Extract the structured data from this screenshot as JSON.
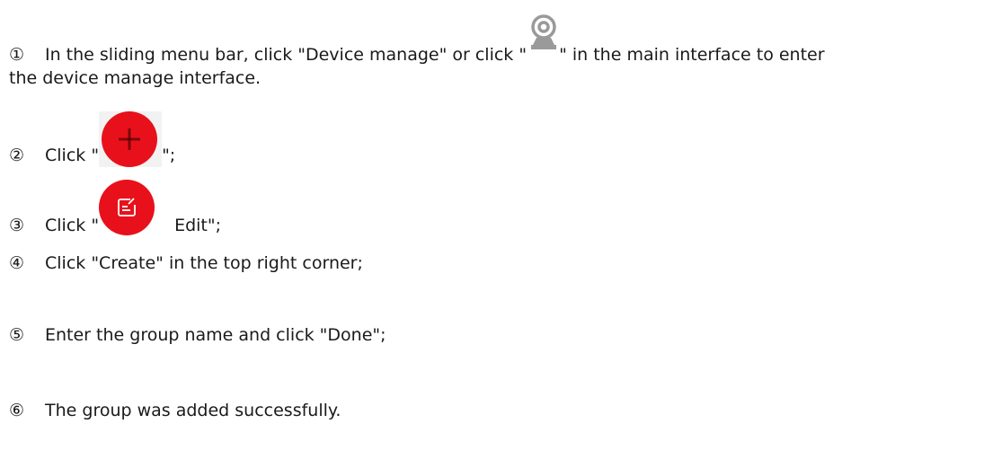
{
  "steps": [
    {
      "number": "①",
      "text_before": "In the sliding menu bar, click \"Device manage\" or click \"",
      "text_after": "\" in the main interface to enter",
      "text_wrap": "the device manage interface.",
      "icon": "camera-icon"
    },
    {
      "number": "②",
      "text_before": "Click \"",
      "text_after": "\";",
      "icon": "plus-icon"
    },
    {
      "number": "③",
      "text_before": "Click \"",
      "text_after": " Edit\";",
      "icon": "edit-icon"
    },
    {
      "number": "④",
      "text": "Click \"Create\" in the top right corner;"
    },
    {
      "number": "⑤",
      "text": "Enter the group name and click \"Done\";"
    },
    {
      "number": "⑥",
      "text": "The group was added successfully."
    }
  ],
  "colors": {
    "icon_red": "#e8111b",
    "camera_gray": "#9a9a9a",
    "text": "#1a1a1a"
  }
}
